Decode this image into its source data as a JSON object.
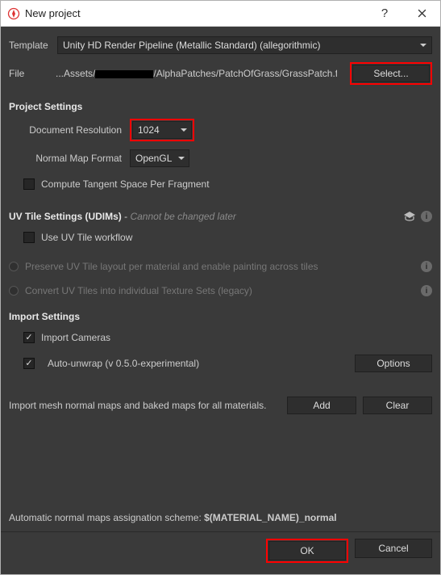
{
  "window": {
    "title": "New project"
  },
  "template": {
    "label": "Template",
    "value": "Unity HD Render Pipeline (Metallic Standard) (allegorithmic)"
  },
  "file": {
    "label": "File",
    "path_prefix": "...Assets/",
    "path_suffix": "/AlphaPatches/PatchOfGrass/GrassPatch.fbx",
    "select_btn": "Select..."
  },
  "project_settings": {
    "title": "Project Settings",
    "doc_res_label": "Document Resolution",
    "doc_res_value": "1024",
    "normal_fmt_label": "Normal Map Format",
    "normal_fmt_value": "OpenGL",
    "compute_tangent": "Compute Tangent Space Per Fragment"
  },
  "uv": {
    "title": "UV Tile Settings (UDIMs)",
    "note": "Cannot be changed later",
    "use_workflow": "Use UV Tile workflow",
    "preserve": "Preserve UV Tile layout per material and enable painting across tiles",
    "convert": "Convert UV Tiles into individual Texture Sets (legacy)"
  },
  "import": {
    "title": "Import Settings",
    "cameras": "Import Cameras",
    "autounwrap": "Auto-unwrap (v 0.5.0-experimental)",
    "options": "Options",
    "normal_maps_text": "Import mesh normal maps and baked maps for all materials.",
    "add": "Add",
    "clear": "Clear"
  },
  "footer": {
    "scheme_label": "Automatic normal maps assignation scheme:",
    "scheme_value": "$(MATERIAL_NAME)_normal",
    "ok": "OK",
    "cancel": "Cancel"
  }
}
